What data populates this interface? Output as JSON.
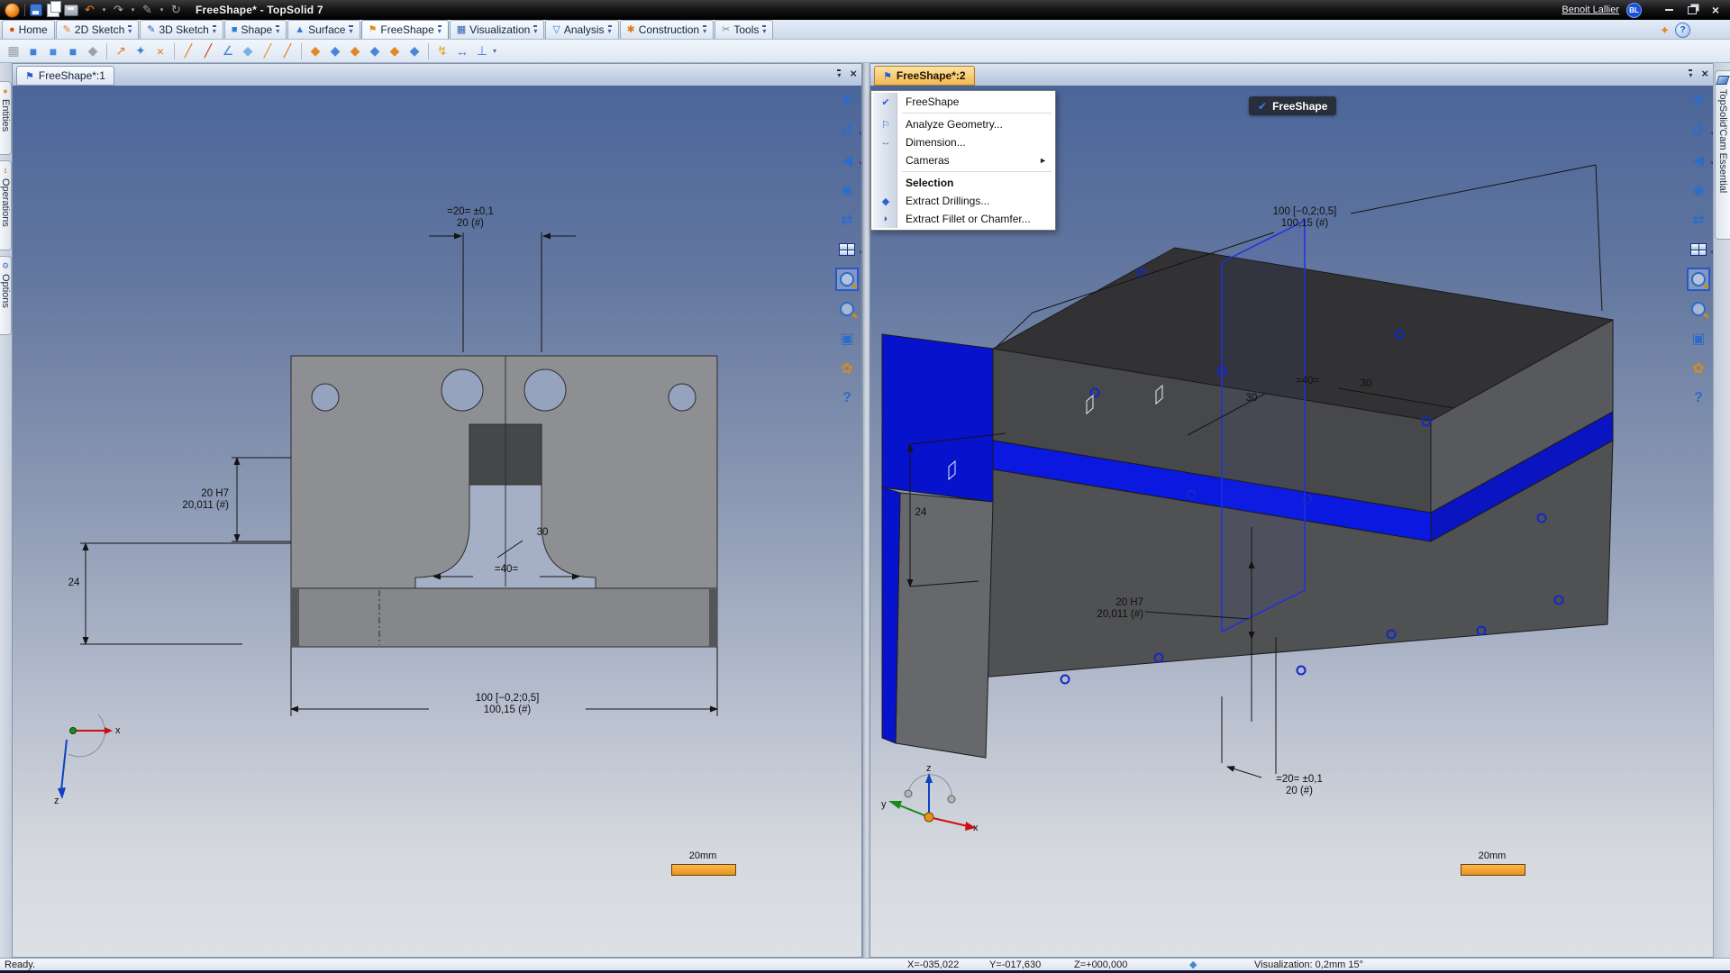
{
  "titlebar": {
    "title": "FreeShape* - TopSolid 7",
    "user": "Benoit Lallier",
    "user_initials": "BL",
    "quick_access": [
      "topsolid-logo",
      "save",
      "copy",
      "print",
      "undo",
      "redo",
      "pen",
      "refresh"
    ]
  },
  "ribbon": {
    "tabs": [
      {
        "label": "Home",
        "has_menu": false,
        "active": false
      },
      {
        "label": "2D Sketch",
        "has_menu": true,
        "active": false
      },
      {
        "label": "3D Sketch",
        "has_menu": true,
        "active": false
      },
      {
        "label": "Shape",
        "has_menu": true,
        "active": false
      },
      {
        "label": "Surface",
        "has_menu": true,
        "active": false
      },
      {
        "label": "FreeShape",
        "has_menu": true,
        "active": true
      },
      {
        "label": "Visualization",
        "has_menu": true,
        "active": false
      },
      {
        "label": "Analysis",
        "has_menu": true,
        "active": false
      },
      {
        "label": "Construction",
        "has_menu": true,
        "active": false
      },
      {
        "label": "Tools",
        "has_menu": true,
        "active": false
      }
    ]
  },
  "toolbar": {
    "groups": [
      [
        "shape-preview",
        "extrude-shape",
        "revolve-shape",
        "loft-shape",
        "remove-material"
      ],
      [
        "frame",
        "point",
        "intersection"
      ],
      [
        "line",
        "axis-line",
        "angle-line",
        "plane-by-line",
        "offset-line",
        "construction-line"
      ],
      [
        "plane",
        "offset-plane",
        "parallel-plane",
        "inclined-plane",
        "plane-through",
        "swept-plane"
      ],
      [
        "quick-dimension",
        "distance-dimension",
        "perpendicular-constraint"
      ]
    ]
  },
  "side_left": {
    "tabs": [
      "Entities",
      "Operations",
      "Options"
    ]
  },
  "side_right": {
    "tab": "TopSolid'Cam Essential"
  },
  "viewport1": {
    "tab": "FreeShape*:1",
    "scale_label": "20mm",
    "axes": {
      "x": "x",
      "z": "z"
    },
    "dims": {
      "top1": "=20= ±0,1",
      "top2": "20 (#)",
      "h7_1": "20 H7",
      "h7_2": "20,011 (#)",
      "d24": "24",
      "d30": "30",
      "d40": "=40=",
      "d100_1": "100 [−0,2;0,5]",
      "d100_2": "100,15 (#)"
    }
  },
  "viewport2": {
    "tab": "FreeShape*:2",
    "badge": "FreeShape",
    "scale_label": "20mm",
    "axes": {
      "x": "x",
      "y": "y",
      "z": "z"
    },
    "dims": {
      "d100_1": "100 [−0,2;0,5]",
      "d100_2": "100,15 (#)",
      "d30_left": "30",
      "d40": "=40=",
      "d30_right": "30",
      "d24": "24",
      "h7_1": "20 H7",
      "h7_2": "20,011 (#)",
      "d20_1": "=20= ±0,1",
      "d20_2": "20 (#)"
    }
  },
  "context_menu": {
    "items": [
      {
        "type": "item",
        "label": "FreeShape",
        "icon": "freeshape-check-icon"
      },
      {
        "type": "separator"
      },
      {
        "type": "item",
        "label": "Analyze Geometry...",
        "icon": "analyze-geometry-icon"
      },
      {
        "type": "item",
        "label": "Dimension...",
        "icon": "dimension-icon"
      },
      {
        "type": "item",
        "label": "Cameras",
        "icon": null,
        "submenu": true
      },
      {
        "type": "separator"
      },
      {
        "type": "header",
        "label": "Selection"
      },
      {
        "type": "item",
        "label": "Extract Drillings...",
        "icon": "extract-drillings-icon"
      },
      {
        "type": "item",
        "label": "Extract Fillet or Chamfer...",
        "icon": "extract-fillet-icon"
      }
    ]
  },
  "viewport_tools": [
    "pan",
    "orbit",
    "view-direction",
    "camera",
    "flip-view",
    "viewport-layout",
    "zoom-window",
    "zoom",
    "clip-box",
    "render-style",
    "help"
  ],
  "statusbar": {
    "ready": "Ready.",
    "x": "X=-035,022",
    "y": "Y=-017,630",
    "z": "Z=+000,000",
    "visualization": "Visualization: 0,2mm 15°"
  },
  "colors": {
    "accent_orange": "#f0a032",
    "selection_blue": "#0a18d0",
    "canvas_top": "#4c669a",
    "canvas_bottom": "#dbdee2"
  }
}
